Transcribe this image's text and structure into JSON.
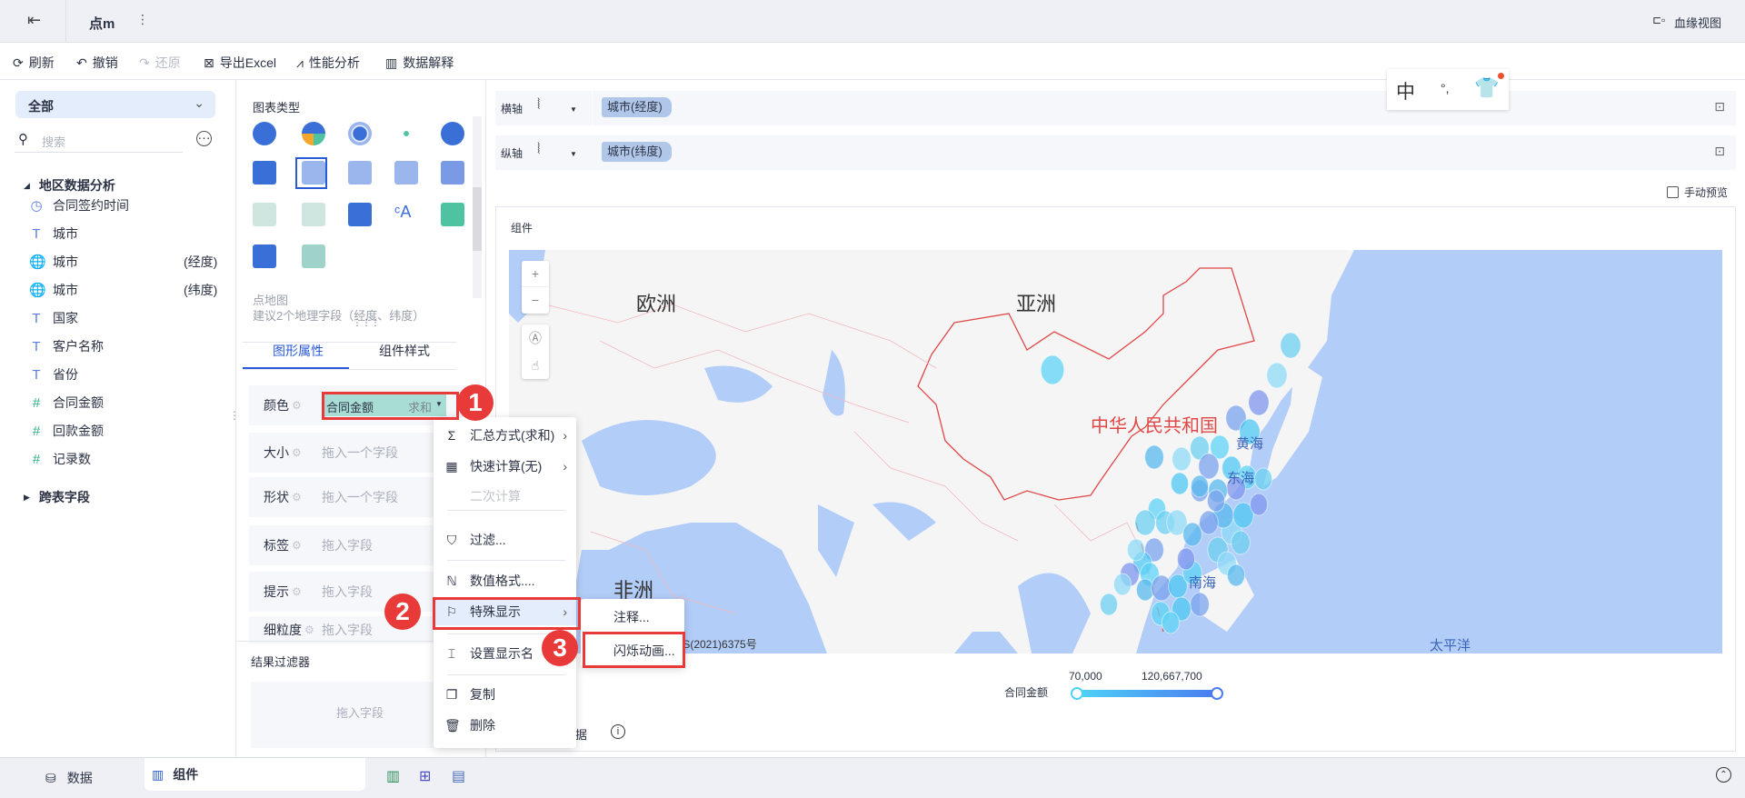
{
  "topbar": {
    "doc_title": "点m",
    "lineage_label": "血缘视图",
    "icons": [
      "exit-icon",
      "more-vertical-icon",
      "lineage-icon"
    ]
  },
  "toolbar": {
    "refresh": "刷新",
    "undo": "撤销",
    "redo": "还原",
    "export": "导出Excel",
    "perf": "性能分析",
    "explain": "数据解释"
  },
  "left": {
    "dropdown": "全部",
    "search_placeholder": "搜索",
    "group": "地区数据分析",
    "fields": [
      {
        "icon": "clock-icon",
        "name": "合同签约时间",
        "suffix": ""
      },
      {
        "icon": "text-icon",
        "name": "城市",
        "suffix": ""
      },
      {
        "icon": "globe-icon",
        "name": "城市",
        "suffix": "(经度)"
      },
      {
        "icon": "globe-icon",
        "name": "城市",
        "suffix": "(纬度)"
      },
      {
        "icon": "text-icon",
        "name": "国家",
        "suffix": ""
      },
      {
        "icon": "text-icon",
        "name": "客户名称",
        "suffix": ""
      },
      {
        "icon": "text-icon",
        "name": "省份",
        "suffix": ""
      },
      {
        "icon": "number-icon",
        "name": "合同金额",
        "suffix": ""
      },
      {
        "icon": "number-icon",
        "name": "回款金额",
        "suffix": ""
      },
      {
        "icon": "number-icon",
        "name": "记录数",
        "suffix": ""
      }
    ],
    "cross_table": "跨表字段"
  },
  "mid": {
    "chart_type_title": "图表类型",
    "chart_desc_title": "点地图",
    "chart_desc": "建议2个地理字段（经度、纬度）",
    "tabs": [
      "图形属性",
      "组件样式"
    ],
    "props": [
      {
        "label": "颜色",
        "field": "合同金额",
        "agg": "求和"
      },
      {
        "label": "大小",
        "placeholder": "拖入一个字段"
      },
      {
        "label": "形状",
        "placeholder": "拖入一个字段"
      },
      {
        "label": "标签",
        "placeholder": "拖入字段"
      },
      {
        "label": "提示",
        "placeholder": "拖入字段"
      },
      {
        "label": "细粒度",
        "placeholder": "拖入字段"
      }
    ],
    "result_filter": "结果过滤器",
    "result_placeholder": "拖入字段"
  },
  "menu": {
    "items": [
      "汇总方式(求和)",
      "快速计算(无)",
      "二次计算",
      "过滤...",
      "数值格式....",
      "特殊显示",
      "设置显示名",
      "复制",
      "删除"
    ],
    "submenu": [
      "注释...",
      "闪烁动画..."
    ],
    "badges": [
      "1",
      "2",
      "3"
    ]
  },
  "axes": {
    "x_label": "横轴",
    "x_field": "城市(经度)",
    "y_label": "纵轴",
    "y_field": "城市(纬度)",
    "manual_preview": "手动预览"
  },
  "ime": {
    "lang": "中",
    "punct": "°,"
  },
  "component": {
    "title": "组件",
    "map_labels": {
      "europe": "欧洲",
      "asia": "亚洲",
      "africa": "非洲",
      "china": "中华人民共和国",
      "yellow_sea": "黄海",
      "east_sea": "东海",
      "south_sea": "南海",
      "pacific": "太平洋"
    },
    "map_credit": "GS(2021)6375号",
    "zoom_in": "+",
    "zoom_out": "−",
    "legend": {
      "title": "合同金额",
      "min": "70,000",
      "max": "120,667,700",
      "min_color": "#4fd2f7",
      "max_color": "#4a7cf0"
    },
    "show_data": "数据"
  },
  "bottom": {
    "data_tab": "数据",
    "component_tab": "组件"
  },
  "colors": {
    "accent": "#3a6fd8",
    "ocean": "#b3cdf9",
    "land": "#f5f5f5",
    "highlight": "#e93a3a"
  }
}
